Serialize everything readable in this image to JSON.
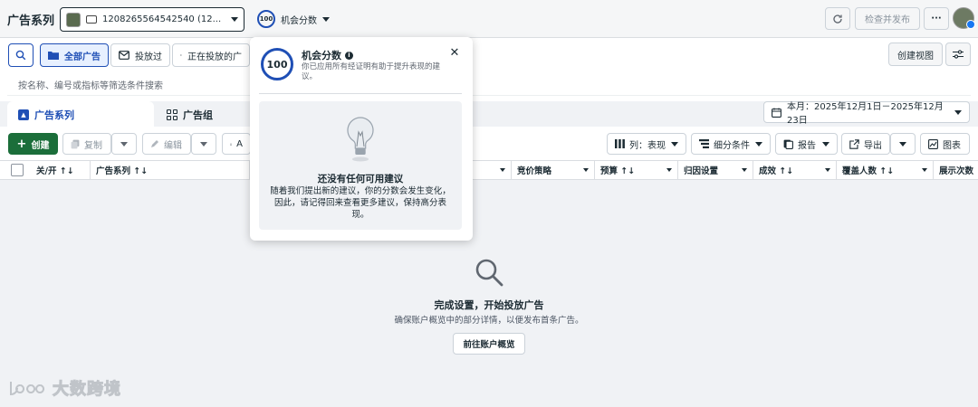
{
  "topbar": {
    "title": "广告系列",
    "account_id": "1208265564542540 (12...",
    "score_value": "100",
    "score_label": "机会分数",
    "publish_label": "检查并发布",
    "more_label": "···"
  },
  "filter_row": {
    "all_ads": "全部广告",
    "delivered": "投放过",
    "running": "正在投放的广",
    "create_view": "创建视图"
  },
  "search": {
    "placeholder": "按名称、编号或指标等筛选条件搜索"
  },
  "tabs": [
    {
      "label": "广告系列"
    },
    {
      "label": "广告组"
    }
  ],
  "date_range": "本月：2025年12月1日－2025年12月23日",
  "toolbar": {
    "create": "创建",
    "copy": "复制",
    "edit": "编辑",
    "ab_test": "A",
    "columns": "列：表现",
    "breakdown": "细分条件",
    "report": "报告",
    "export": "导出",
    "chart": "图表"
  },
  "table": {
    "columns": [
      "关/开 ↑↓",
      "广告系列 ↑↓",
      "竞价策略",
      "预算 ↑↓",
      "归因设置",
      "成效 ↑↓",
      "覆盖人数 ↑↓",
      "展示次数"
    ]
  },
  "empty_state": {
    "title": "完成设置，开始投放广告",
    "description": "确保账户概览中的部分详情，以便发布首条广告。",
    "button": "前往账户概览"
  },
  "popover": {
    "score": "100",
    "title": "机会分数",
    "subtitle": "你已应用所有经证明有助于提升表现的建议。",
    "card_title": "还没有任何可用建议",
    "card_desc": "随着我们提出新的建议，你的分数会发生变化，因此，请记得回来查看更多建议，保持高分表现。"
  },
  "watermark": "大数跨境",
  "colors": {
    "accent": "#1f4fb5",
    "create_green": "#1b6e3a",
    "bg": "#f0f2f5"
  }
}
